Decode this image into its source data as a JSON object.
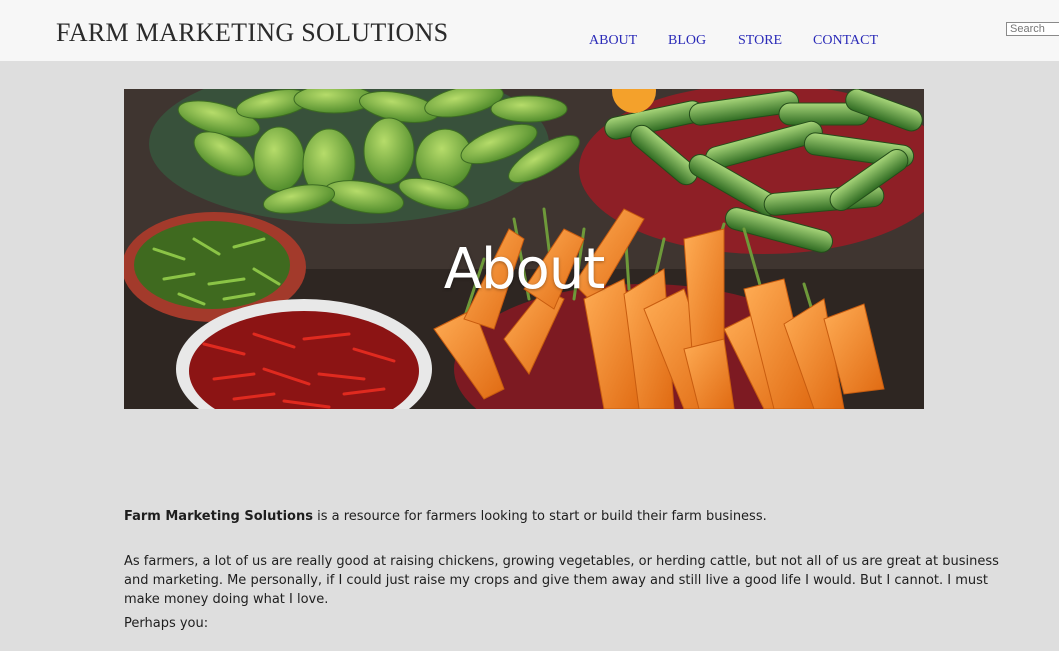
{
  "header": {
    "brand": "FARM MARKETING SOLUTIONS",
    "nav": [
      "ABOUT",
      "BLOG",
      "STORE",
      "CONTACT"
    ],
    "search_placeholder": "Search"
  },
  "hero": {
    "title": "About",
    "image": "vegetables-market-photo"
  },
  "content": {
    "p1_bold": "Farm Marketing Solutions",
    "p1_rest": " is a resource for farmers looking to start or build their farm business.",
    "p2": "As farmers, a lot of us are really good at raising chickens, growing vegetables, or herding cattle, but not all of us are great at business and marketing. Me personally, if I could just raise my crops and give them away and still live a good life I would. But I cannot. I must make money doing what I love.",
    "p3": "Perhaps you:"
  },
  "colors": {
    "page_bg": "#dedede",
    "header_bg": "#f7f7f7",
    "nav_link": "#2b2bb8"
  }
}
